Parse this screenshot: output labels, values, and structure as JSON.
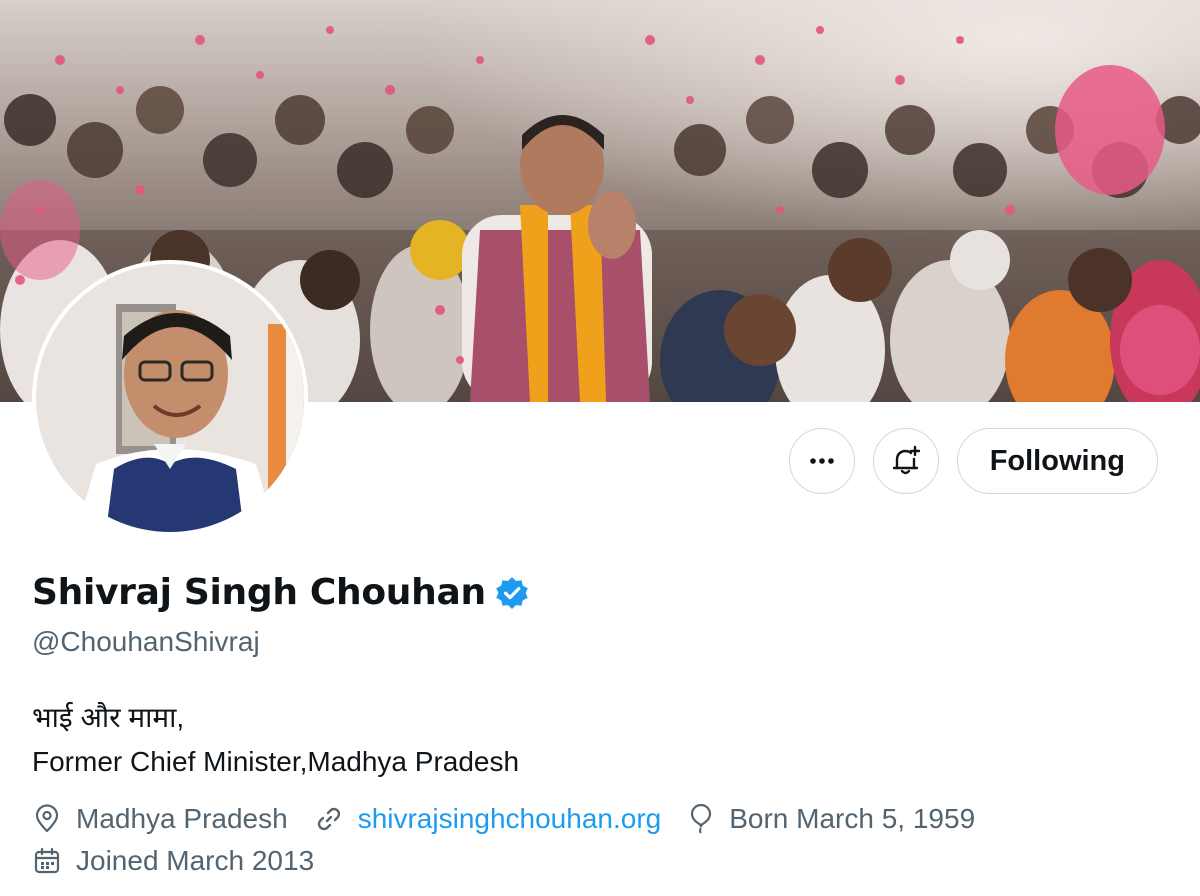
{
  "profile": {
    "display_name": "Shivraj Singh Chouhan",
    "handle": "@ChouhanShivraj",
    "verified": true,
    "bio_lines": [
      "भाई और मामा,",
      "Former Chief Minister,Madhya Pradesh"
    ],
    "location": "Madhya Pradesh",
    "website": "shivrajsinghchouhan.org",
    "birthday": "Born March 5, 1959",
    "joined": "Joined March 2013"
  },
  "actions": {
    "more_icon": "more-horizontal-icon",
    "notify_icon": "bell-plus-icon",
    "follow_label": "Following"
  },
  "icons": {
    "location": "location-pin-icon",
    "website": "link-icon",
    "birthday": "balloon-icon",
    "joined": "calendar-icon",
    "verified": "verified-badge-icon"
  },
  "colors": {
    "accent": "#1d9bf0",
    "text_primary": "#0f1419",
    "text_secondary": "#536471",
    "border": "#cfd9de"
  }
}
